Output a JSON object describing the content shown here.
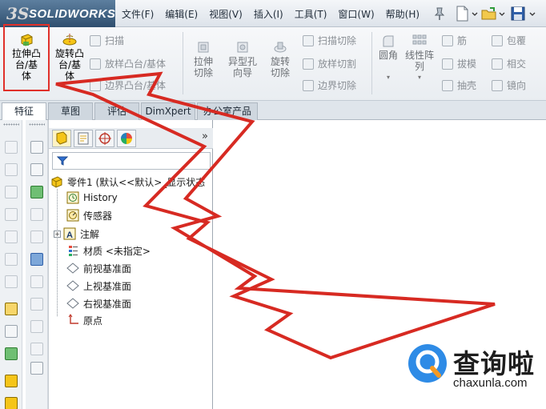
{
  "app": {
    "logo_mark": "3S",
    "logo_text": "SOLIDWORKS"
  },
  "menu": [
    "文件(F)",
    "编辑(E)",
    "视图(V)",
    "插入(I)",
    "工具(T)",
    "窗口(W)",
    "帮助(H)"
  ],
  "ribbon": {
    "extrude_boss": "拉伸凸台/基体",
    "revolve_boss": "旋转凸台/基体",
    "sweep": "扫描",
    "loft": "放样凸台/基体",
    "boundary_boss": "边界凸台/基体",
    "extrude_cut": "拉伸切除",
    "hole_wizard": "异型孔向导",
    "revolve_cut": "旋转切除",
    "swept_cut": "扫描切除",
    "lofted_cut": "放样切割",
    "boundary_cut": "边界切除",
    "fillet": "圆角",
    "linear_pattern": "线性阵列",
    "rib": "筋",
    "draft": "拔模",
    "shell": "抽壳",
    "wrap": "包覆",
    "intersect": "相交",
    "mirror": "镜向"
  },
  "tabs": [
    {
      "label": "特征",
      "active": true
    },
    {
      "label": "草图",
      "active": false
    },
    {
      "label": "评估",
      "active": false
    },
    {
      "label": "DimXpert",
      "active": false
    },
    {
      "label": "办公室产品",
      "active": false
    }
  ],
  "feature_tree": {
    "more_glyph": "»",
    "root": "零件1 (默认<<默认>_显示状态",
    "items": [
      {
        "label": "History",
        "icon": "history-icon"
      },
      {
        "label": "传感器",
        "icon": "sensor-icon"
      },
      {
        "label": "注解",
        "icon": "annotation-icon",
        "expandable": true
      },
      {
        "label": "材质 <未指定>",
        "icon": "material-icon"
      },
      {
        "label": "前视基准面",
        "icon": "plane-icon"
      },
      {
        "label": "上视基准面",
        "icon": "plane-icon"
      },
      {
        "label": "右视基准面",
        "icon": "plane-icon"
      },
      {
        "label": "原点",
        "icon": "origin-icon"
      }
    ]
  },
  "watermark": {
    "brand_cn": "查询啦",
    "url": "chaxunla.com"
  },
  "colors": {
    "highlight_red": "#e0302a",
    "watermark_blue": "#2e8be6",
    "watermark_orange": "#f59a23"
  }
}
